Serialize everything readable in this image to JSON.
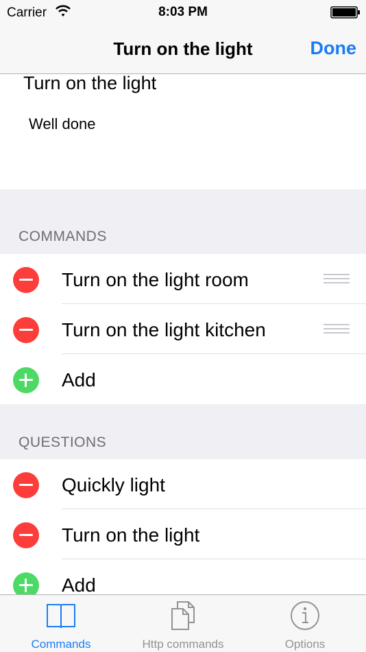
{
  "status_bar": {
    "carrier": "Carrier",
    "time": "8:03 PM"
  },
  "nav": {
    "title": "Turn on the light",
    "done_label": "Done"
  },
  "intent": {
    "name": "Turn on the light",
    "response": "Well done"
  },
  "commands": {
    "header": "COMMANDS",
    "items": [
      {
        "label": "Turn on the light room"
      },
      {
        "label": "Turn on the light kitchen"
      }
    ],
    "add_label": "Add"
  },
  "questions": {
    "header": "QUESTIONS",
    "items": [
      {
        "label": "Quickly light"
      },
      {
        "label": "Turn on the light"
      }
    ],
    "add_label": "Add"
  },
  "tabs": [
    {
      "label": "Commands",
      "icon": "book-icon",
      "active": true
    },
    {
      "label": "Http commands",
      "icon": "documents-icon",
      "active": false
    },
    {
      "label": "Options",
      "icon": "info-icon",
      "active": false
    }
  ],
  "colors": {
    "accent": "#1a7cf4",
    "delete": "#fc3d39",
    "add": "#4cd964"
  }
}
